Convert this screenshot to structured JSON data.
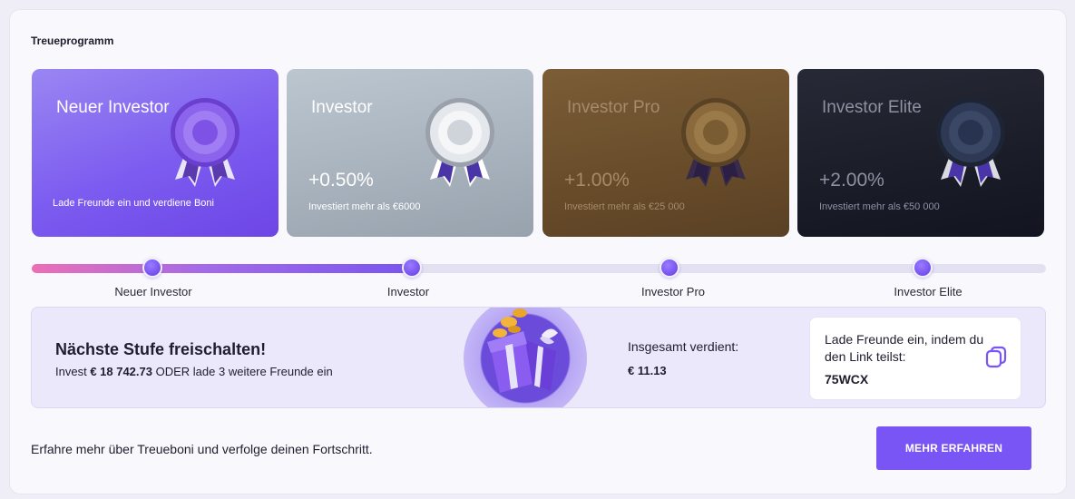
{
  "section": {
    "title": "Treueprogramm"
  },
  "tiers": [
    {
      "name": "Neuer Investor",
      "rate": "",
      "description": "Lade Freunde ein und verdiene Boni",
      "color": "#7c5cf0"
    },
    {
      "name": "Investor",
      "rate": "+0.50%",
      "description": "Investiert mehr als €6000",
      "color": "#a9b3be"
    },
    {
      "name": "Investor Pro",
      "rate": "+1.00%",
      "description": "Investiert mehr als €25 000",
      "color": "#684c2a"
    },
    {
      "name": "Investor Elite",
      "rate": "+2.00%",
      "description": "Investiert mehr als €50 000",
      "color": "#1a1c27"
    }
  ],
  "progress": {
    "steps": [
      "Neuer Investor",
      "Investor",
      "Investor Pro",
      "Investor Elite"
    ],
    "completed_fraction": 0.375
  },
  "unlock": {
    "title": "Nächste Stufe freischalten!",
    "text_prefix": "Invest",
    "amount": "€ 18 742.73",
    "text_suffix": "ODER lade 3 weitere Freunde ein"
  },
  "earned": {
    "label": "Insgesamt verdient:",
    "value": "€ 11.13"
  },
  "invite": {
    "text": "Lade Freunde ein, indem du den Link teilst:",
    "code": "75WCX"
  },
  "footer": {
    "text": "Erfahre mehr über Treueboni und verfolge deinen Fortschritt.",
    "button_label": "MEHR ERFAHREN"
  },
  "icons": {
    "badge": "medal-icon",
    "gift": "gift-icon",
    "copy": "copy-icon"
  },
  "colors": {
    "accent": "#7a55f5",
    "progress_start": "#ec6fb6"
  }
}
